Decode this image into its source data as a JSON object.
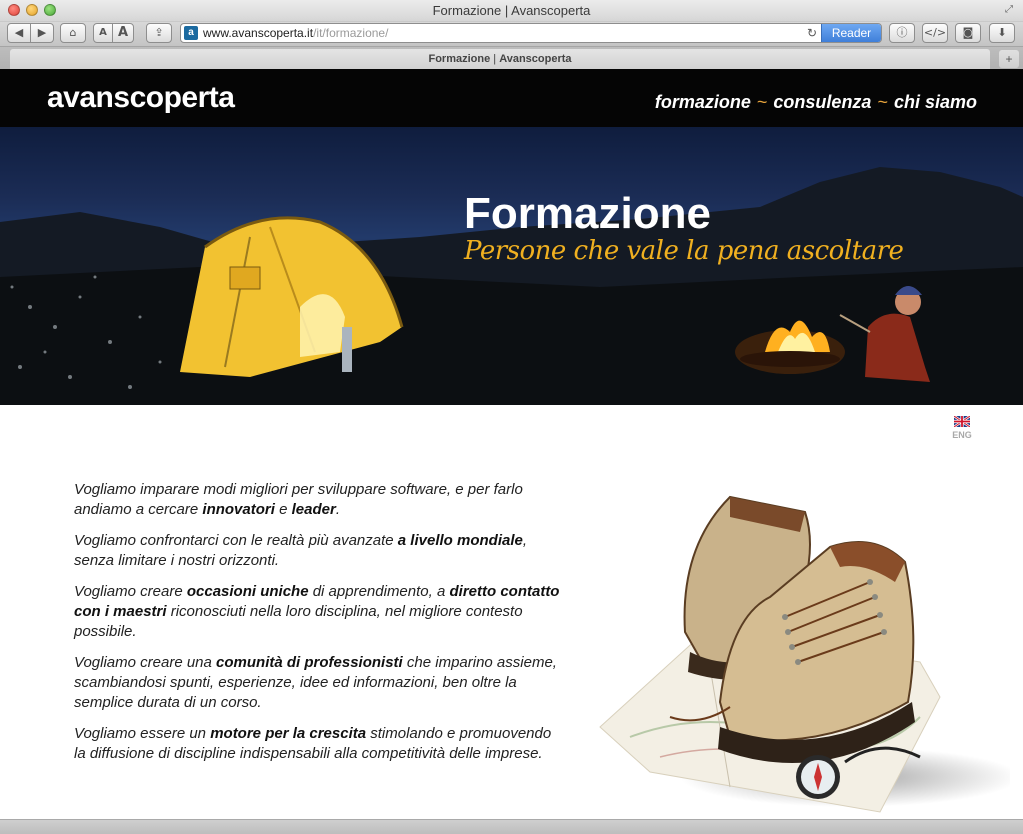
{
  "window": {
    "title": "Formazione | Avanscoperta"
  },
  "toolbar": {
    "url_host": "www.avanscoperta.it",
    "url_path": "/it/formazione/",
    "reader_label": "Reader",
    "font_small_label": "A",
    "font_big_label": "A"
  },
  "tab": {
    "title_part1": "Formazione",
    "title_sep": "|",
    "title_part2": "Avanscoperta"
  },
  "site": {
    "logo": "avanscoperta",
    "nav": [
      {
        "label": "formazione"
      },
      {
        "label": "consulenza"
      },
      {
        "label": "chi siamo"
      }
    ],
    "nav_separator": "~"
  },
  "hero": {
    "title": "Formazione",
    "subtitle": "Persone che vale la pena ascoltare"
  },
  "language": {
    "label": "ENG",
    "flag": "uk-flag-icon"
  },
  "content": {
    "paragraphs": [
      [
        "Vogliamo imparare modi migliori per sviluppare software, e per farlo andiamo a cercare ",
        {
          "b": "innovatori"
        },
        " e ",
        {
          "b": "leader"
        },
        "."
      ],
      [
        "Vogliamo confrontarci con le realtà più avanzate ",
        {
          "b": "a livello mondiale"
        },
        ", senza limitare i nostri orizzonti."
      ],
      [
        "Vogliamo creare ",
        {
          "b": "occasioni uniche"
        },
        " di apprendimento, a ",
        {
          "b": "diretto contatto con i maestri"
        },
        " riconosciuti nella loro disciplina, nel migliore contesto possibile."
      ],
      [
        "Vogliamo creare una ",
        {
          "b": "comunità di professionisti"
        },
        " che imparino assieme, scambiandosi spunti, esperienze, idee ed informazioni, ben oltre la semplice durata di un corso."
      ],
      [
        "Vogliamo essere un ",
        {
          "b": "motore per la crescita"
        },
        " stimolando e promuovendo la diffusione di discipline indispensabili alla competitività delle imprese."
      ]
    ]
  },
  "colors": {
    "header_bg": "#050505",
    "accent_orange": "#f0b020",
    "nav_separator": "#e5a23b"
  }
}
